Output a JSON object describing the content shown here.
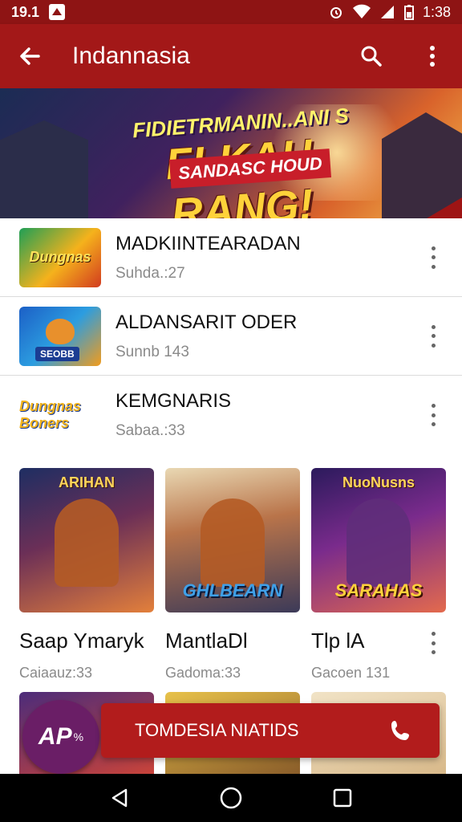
{
  "status_bar": {
    "time": "19.1",
    "clock": "1:38"
  },
  "app_bar": {
    "title": "Indannasia",
    "icons": [
      "back-arrow-icon",
      "search-icon",
      "more-vert-icon"
    ]
  },
  "banner": {
    "subtitle": "FIDIETRMANIN..ANI S",
    "title": "FLKAH RANG!",
    "ribbon": "SANDASC HOUD"
  },
  "list": [
    {
      "thumb_text": "Dungnas",
      "title": "MADKIINTEARADAN",
      "subtitle": "Suhda.:27"
    },
    {
      "thumb_text": "SEOBB",
      "title": "ALDANSARIT ODER",
      "subtitle": "Sunnb 143"
    },
    {
      "thumb_text": "Dungnas Boners",
      "title": "KEMGNARIS",
      "subtitle": "Sabaa.:33"
    }
  ],
  "grid": [
    {
      "banner": "ARIHAN",
      "logo": "",
      "title": "Saap Ymaryk",
      "subtitle": "Caiaauz:33"
    },
    {
      "banner": "",
      "logo": "GHLBEARN",
      "title": "MantlaDl",
      "subtitle": "Gadoma:33"
    },
    {
      "banner": "NuoNusns",
      "logo": "SARAHAS",
      "title": "Tlp lA",
      "subtitle": "Gacoen 131"
    }
  ],
  "promo_fab": {
    "label": "AP",
    "suffix": "%"
  },
  "cta": {
    "label": "TOMDESIA NIATIDS",
    "icon": "phone-icon"
  },
  "nav_bar": {
    "icons": [
      "back-triangle-icon",
      "home-circle-icon",
      "recents-square-icon"
    ]
  },
  "colors": {
    "status_bar": "#8e1414",
    "app_bar": "#a31818",
    "cta": "#b21c1c",
    "promo": "#6a1e66"
  }
}
